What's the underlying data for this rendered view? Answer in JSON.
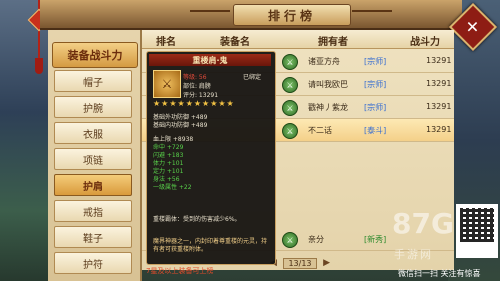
{
  "title": "排行榜",
  "close_label": "✕",
  "sidebar": {
    "top": "装备战斗力",
    "items": [
      "帽子",
      "护腕",
      "衣服",
      "项链",
      "护肩",
      "戒指",
      "鞋子",
      "护符"
    ],
    "active_index": 4
  },
  "table": {
    "headers": [
      "排名",
      "装备名",
      "拥有者",
      "战斗力"
    ],
    "rows": [
      {
        "icon": "⚔",
        "name": "诸亚方舟",
        "sect": "[宗师]",
        "power": "13291",
        "highlight": false
      },
      {
        "icon": "⚔",
        "name": "请叫我欧巴",
        "sect": "[宗师]",
        "power": "13291",
        "highlight": false
      },
      {
        "icon": "⚔",
        "name": "戳神丿紫龙",
        "sect": "[宗师]",
        "power": "13291",
        "highlight": false
      },
      {
        "icon": "⚔",
        "name": "不二话",
        "sect": "[泰斗]",
        "power": "13291",
        "highlight": true
      },
      {
        "icon": "⚔",
        "name": "亲分",
        "sect": "[新秀]",
        "power": "",
        "highlight": false
      }
    ]
  },
  "pager": {
    "prev": "◀",
    "text": "13/13",
    "next": "▶"
  },
  "tooltip": {
    "title": "重楼肩·鬼",
    "bound": "已绑定",
    "level": "等级: 56",
    "slot": "部位: 肩膀",
    "score": "评分: 13291",
    "stars": "★★★★★★★★★★",
    "lines": [
      "基础外功防御 +489",
      "基础内功防御 +489",
      "血上限 +8938",
      "命中 +729",
      "闪避 +183",
      "体力 +101",
      "定力 +101",
      "身法 +56",
      "一级属性 +22",
      "重楼霸体：受到的伤害减少6%。",
      "魔界神器之一，内封印着尊重楼的元灵，持有者可获重楼附体。"
    ]
  },
  "bottom_note": "7星及以上装备可上榜",
  "watermark": {
    "logo": "87G",
    "sub": "手游网",
    "scan": "微信扫一扫 关注有惊喜"
  }
}
